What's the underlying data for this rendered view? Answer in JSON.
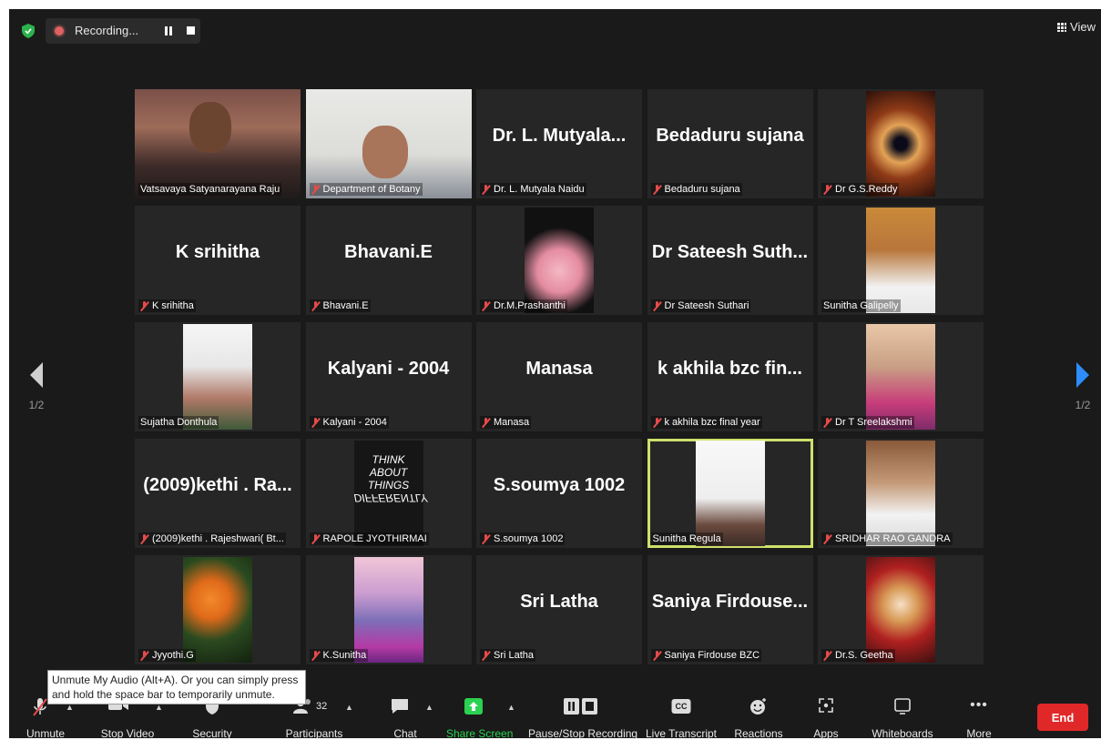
{
  "top_bar": {
    "recording_label": "Recording...",
    "view_label": "View"
  },
  "pager": {
    "left": "1/2",
    "right": "1/2"
  },
  "tiles": [
    {
      "big": "",
      "name": "Vatsavaya Satyanarayana Raju",
      "muted": false,
      "photo": "vats"
    },
    {
      "big": "",
      "name": "Department of Botany",
      "muted": true,
      "photo": "bot"
    },
    {
      "big": "Dr. L. Mutyala...",
      "name": "Dr. L. Mutyala Naidu",
      "muted": true,
      "photo": ""
    },
    {
      "big": "Bedaduru sujana",
      "name": "Bedaduru sujana",
      "muted": true,
      "photo": ""
    },
    {
      "big": "",
      "name": "Dr G.S.Reddy",
      "muted": true,
      "photo": "gs"
    },
    {
      "big": "K srihitha",
      "name": "K srihitha",
      "muted": true,
      "photo": ""
    },
    {
      "big": "Bhavani.E",
      "name": "Bhavani.E",
      "muted": true,
      "photo": ""
    },
    {
      "big": "",
      "name": "Dr.M.Prashanthi",
      "muted": true,
      "photo": "rose"
    },
    {
      "big": "Dr Sateesh Suth...",
      "name": "Dr Sateesh Suthari",
      "muted": true,
      "photo": ""
    },
    {
      "big": "",
      "name": "Sunitha Galipelly",
      "muted": false,
      "photo": "sunG"
    },
    {
      "big": "",
      "name": "Sujatha Donthula",
      "muted": false,
      "photo": "suj"
    },
    {
      "big": "Kalyani - 2004",
      "name": "Kalyani - 2004",
      "muted": true,
      "photo": ""
    },
    {
      "big": "Manasa",
      "name": "Manasa",
      "muted": true,
      "photo": ""
    },
    {
      "big": "k akhila bzc fin...",
      "name": "k akhila bzc final year",
      "muted": true,
      "photo": ""
    },
    {
      "big": "",
      "name": "Dr T Sreelakshmi",
      "muted": true,
      "photo": "sree"
    },
    {
      "big": "(2009)kethi . Ra...",
      "name": "(2009)kethi . Rajeshwari( Bt...",
      "muted": true,
      "photo": ""
    },
    {
      "big": "",
      "name": "RAPOLE JYOTHIRMAI",
      "muted": true,
      "photo": "think"
    },
    {
      "big": "S.soumya 1002",
      "name": "S.soumya 1002",
      "muted": true,
      "photo": ""
    },
    {
      "big": "",
      "name": "Sunitha Regula",
      "muted": false,
      "photo": "regula"
    },
    {
      "big": "",
      "name": "SRIDHAR RAO GANDRA",
      "muted": true,
      "photo": "sridhar"
    },
    {
      "big": "",
      "name": "Jyyothi.G",
      "muted": true,
      "photo": "jyo"
    },
    {
      "big": "",
      "name": "K.Sunitha",
      "muted": true,
      "photo": "ksun"
    },
    {
      "big": "Sri Latha",
      "name": "Sri Latha",
      "muted": true,
      "photo": ""
    },
    {
      "big": "Saniya Firdouse...",
      "name": "Saniya Firdouse BZC",
      "muted": true,
      "photo": ""
    },
    {
      "big": "",
      "name": "Dr.S. Geetha",
      "muted": true,
      "photo": "geetha"
    }
  ],
  "think_text": [
    "THINK",
    "ABOUT",
    "THINGS",
    "DIFFERENTLY"
  ],
  "tooltip": "Unmute My Audio (Alt+A). Or you can simply press and hold the space bar to temporarily unmute.",
  "toolbar": {
    "unmute": "Unmute",
    "stop_video": "Stop Video",
    "security": "Security",
    "participants": "Participants",
    "participants_count": "32",
    "chat": "Chat",
    "share_screen": "Share Screen",
    "pause_stop": "Pause/Stop Recording",
    "live_transcript": "Live Transcript",
    "cc": "CC",
    "reactions": "Reactions",
    "apps": "Apps",
    "whiteboards": "Whiteboards",
    "more": "More",
    "end": "End"
  },
  "colors": {
    "active_speaker": "#cfe06b",
    "share_green": "#2bd150",
    "end_red": "#e02828",
    "pager_blue": "#2d8cff"
  }
}
